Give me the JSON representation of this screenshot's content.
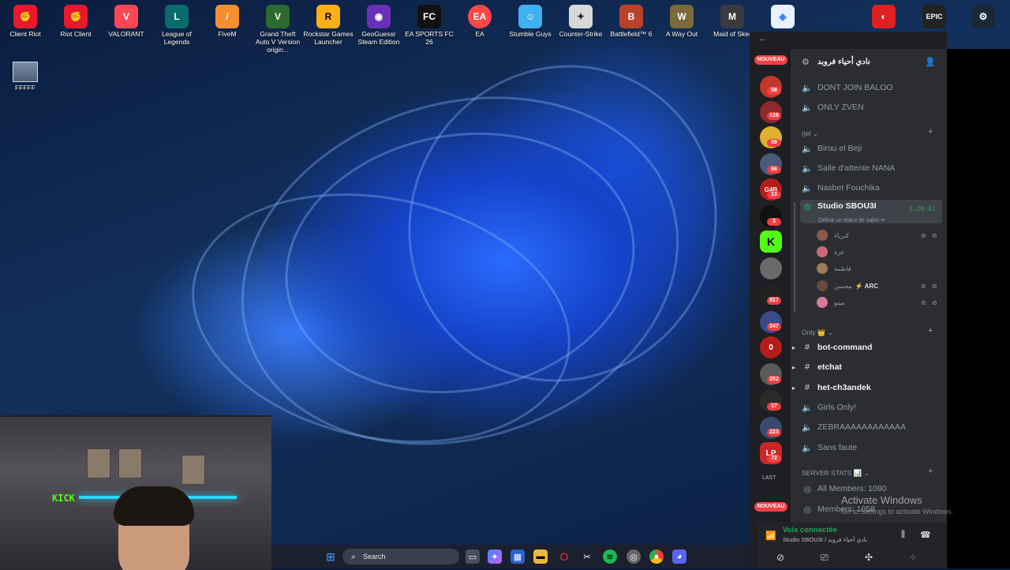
{
  "desktop": {
    "icons": [
      {
        "label": "Client Riot",
        "color": "#e8192c",
        "glyph": "✊"
      },
      {
        "label": "Riot Client",
        "color": "#e8192c",
        "glyph": "✊"
      },
      {
        "label": "VALORANT",
        "color": "#ff4655",
        "glyph": "V"
      },
      {
        "label": "League of Legends",
        "color": "#0a6b6b",
        "glyph": "L"
      },
      {
        "label": "FiveM",
        "color": "#f78f2e",
        "glyph": "/"
      },
      {
        "label": "Grand Theft Auto V Version origin...",
        "color": "#2d6a2d",
        "glyph": "V"
      },
      {
        "label": "Rockstar Games Launcher",
        "color": "#fcaf17",
        "glyph": "R"
      },
      {
        "label": "GeoGuessr Steam Edition",
        "color": "#6a2fb8",
        "glyph": "◉"
      },
      {
        "label": "EA SPORTS FC 26",
        "color": "#111111",
        "glyph": "FC"
      },
      {
        "label": "EA",
        "color": "#ff4747",
        "glyph": "EA"
      },
      {
        "label": "Stumble Guys",
        "color": "#3fb0f0",
        "glyph": "☺"
      },
      {
        "label": "Counter-Strike",
        "color": "#d8d8d8",
        "glyph": "✦"
      },
      {
        "label": "Battlefield™ 6",
        "color": "#b8432a",
        "glyph": "B"
      },
      {
        "label": "A Way Out",
        "color": "#7a6a3a",
        "glyph": "W"
      },
      {
        "label": "Maid of Sker",
        "color": "#3a3a40",
        "glyph": "M"
      },
      {
        "label": "",
        "color": "#e8f2ff",
        "glyph": "◈"
      },
      {
        "label": "",
        "color": "#e02020",
        "glyph": "◐"
      },
      {
        "label": "",
        "color": "#222222",
        "glyph": "EPIC"
      },
      {
        "label": "",
        "color": "#1b2838",
        "glyph": "⚙"
      }
    ],
    "file": {
      "label": "FFFFF"
    }
  },
  "taskbar": {
    "search_label": "Search",
    "search_icon": "search-icon",
    "apps": [
      "start-icon",
      "task-view-icon",
      "copilot-icon",
      "store-icon",
      "explorer-icon",
      "opera-icon",
      "capcut-icon",
      "spotify-icon",
      "chrome-beta-icon",
      "chrome-icon",
      "discord-icon"
    ]
  },
  "discord": {
    "server_name": "نادي أحياء فروبد",
    "rail": {
      "nouveau_top": "NOUVEAU",
      "nouveau_bottom": "NOUVEAU",
      "last_label": "LAST",
      "servers": [
        {
          "badge": "58",
          "color": "#c0392b"
        },
        {
          "badge": "126",
          "color": "#8e2a2a"
        },
        {
          "badge": "59",
          "color": "#e0b030"
        },
        {
          "badge": "86",
          "color": "#4a5a7a"
        },
        {
          "badge": "13",
          "color": "#b71c1c",
          "glyph": "G4B"
        },
        {
          "badge": "3",
          "color": "#111111"
        },
        {
          "badge": "",
          "color": "#53fc18",
          "glyph": "K"
        },
        {
          "badge": "",
          "color": "#6a6a6a"
        },
        {
          "badge": "817",
          "color": "#222222"
        },
        {
          "badge": "247",
          "color": "#3a4a8a"
        },
        {
          "badge": "",
          "color": "#b71c1c",
          "glyph": "0"
        },
        {
          "badge": "252",
          "color": "#5a5a5a"
        },
        {
          "badge": "17",
          "color": "#2a2a2a"
        },
        {
          "badge": "223",
          "color": "#3a4a6a"
        },
        {
          "badge": "72",
          "color": "#c62828",
          "glyph": "LP"
        }
      ]
    },
    "categories": {
      "rjel": "rjel",
      "only": "Only 👑",
      "server_stats": "SERVER STATS 📊"
    },
    "channels": {
      "dont_join": "DONT JOIN BALOO",
      "only_zven": "ONLY ZVEN",
      "birou": "Birou el Beji",
      "salle": "Salle d'attente NANA",
      "nasbet": "Nasbet Fouchika",
      "studio": "Studio SBOU3I",
      "bot_command": "bot-command",
      "etchat": "etchat",
      "het": "het-ch3andek",
      "girls": "Girls Only!",
      "zebra": "ZEBRAAAAAAAAAAAA",
      "sans": "Sans faute",
      "all_members": "All Members: 1080",
      "members": "Members: 1058"
    },
    "studio_timer": "3:28:01",
    "studio_status": "Définir un statut de salon ✏",
    "voice_users": [
      {
        "name": "كبرياء",
        "color": "#8a5a4a",
        "tag": "",
        "muted": true
      },
      {
        "name": "عزة",
        "color": "#c86a7a",
        "tag": "",
        "muted": false
      },
      {
        "name": "فاطمة",
        "color": "#a07a5a",
        "tag": "",
        "muted": false
      },
      {
        "name": "محسن",
        "color": "#6a4a3a",
        "tag": "⚡ ARC",
        "muted": true
      },
      {
        "name": "مينو",
        "color": "#d87a9a",
        "tag": "",
        "muted": true
      }
    ],
    "watermark": "Activate Windows",
    "watermark_sub": "Go to Settings to activate Windows.",
    "voice_panel": {
      "status": "Voix connectée",
      "channel": "Studio SBOU3I / نادي أحياء فروبد"
    }
  }
}
